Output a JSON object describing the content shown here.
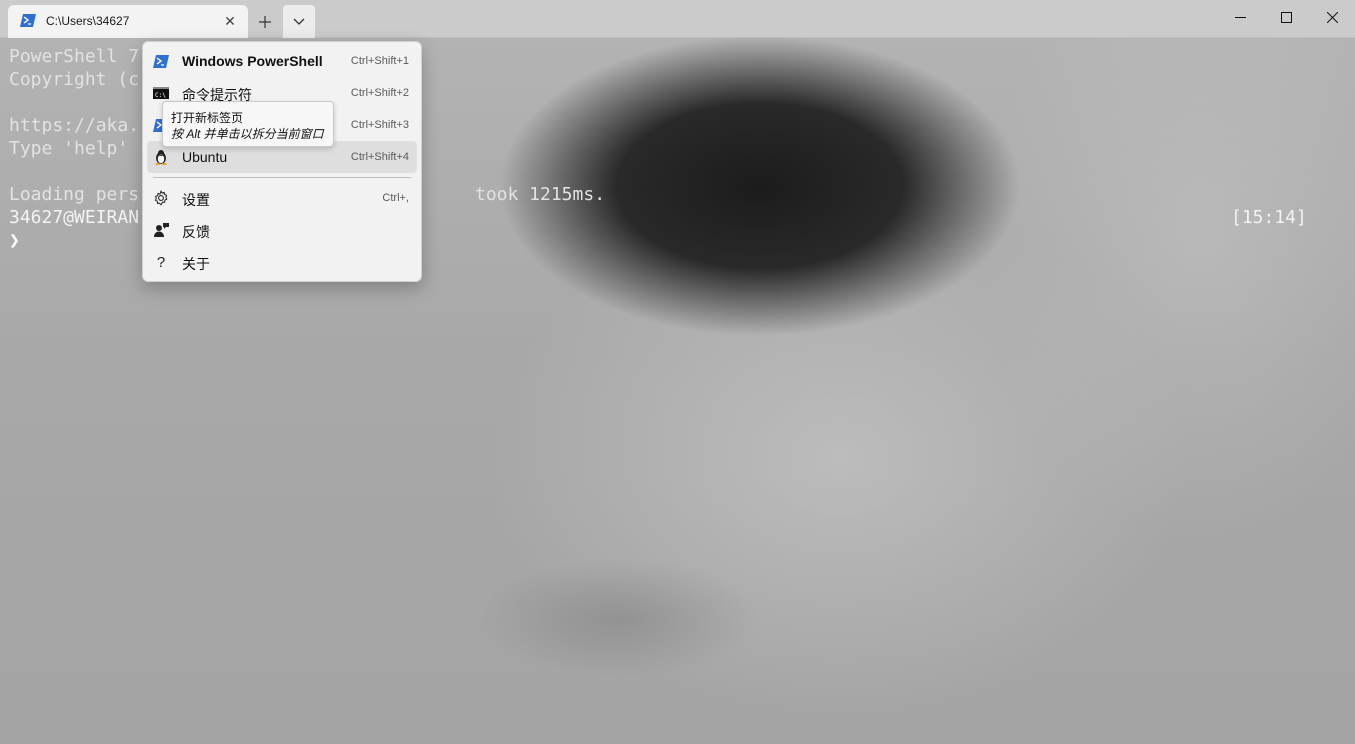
{
  "window": {
    "tab": {
      "title": "C:\\Users\\34627",
      "close_glyph": "✕",
      "icon": "powershell-icon"
    },
    "new_tab_glyph": "+",
    "dropdown_icon": "chevron-down-icon",
    "controls": {
      "minimize": "minimize-icon",
      "maximize": "maximize-icon",
      "close": "close-icon"
    }
  },
  "terminal": {
    "lines": [
      "PowerShell 7",
      "Copyright (c",
      "",
      "https://aka.",
      "Type 'help'",
      "",
      "Loading pers                               took 1215ms.",
      "34627@WEIRAN"
    ],
    "prompt_glyph": "❯",
    "time": "[15:14]"
  },
  "menu": {
    "items": [
      {
        "label": "Windows PowerShell",
        "shortcut": "Ctrl+Shift+1",
        "icon": "powershell-icon",
        "bold": true
      },
      {
        "label": "命令提示符",
        "shortcut": "Ctrl+Shift+2",
        "icon": "cmd-icon"
      },
      {
        "label": "",
        "shortcut": "Ctrl+Shift+3",
        "icon": "powershell-icon"
      },
      {
        "label": "Ubuntu",
        "shortcut": "Ctrl+Shift+4",
        "icon": "linux-penguin-icon"
      },
      {
        "label": "设置",
        "shortcut": "Ctrl+,",
        "icon": "gear-icon"
      },
      {
        "label": "反馈",
        "shortcut": "",
        "icon": "feedback-icon"
      },
      {
        "label": "关于",
        "shortcut": "",
        "icon": "question-icon"
      }
    ]
  },
  "tooltip": {
    "line1": "打开新标签页",
    "line2": "按 Alt 并单击以拆分当前窗口"
  }
}
